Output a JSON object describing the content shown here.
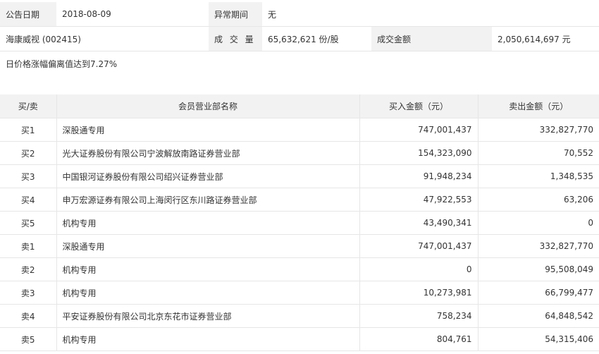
{
  "header": {
    "announce_date_label": "公告日期",
    "announce_date_value": "2018-08-09",
    "abnormal_period_label": "异常期间",
    "abnormal_period_value": "无",
    "stock_name": "海康威视 (002415)",
    "volume_label": "成 交 量",
    "volume_value": "65,632,621 份/股",
    "turnover_label": "成交金额",
    "turnover_value": "2,050,614,697 元",
    "reason": "日价格涨幅偏离值达到7.27%"
  },
  "table": {
    "columns": [
      "买/卖",
      "会员营业部名称",
      "买入金额（元）",
      "卖出金额（元）"
    ],
    "rows": [
      {
        "side": "买1",
        "name": "深股通专用",
        "buy": "747,001,437",
        "sell": "332,827,770"
      },
      {
        "side": "买2",
        "name": "光大证券股份有限公司宁波解放南路证券营业部",
        "buy": "154,323,090",
        "sell": "70,552"
      },
      {
        "side": "买3",
        "name": "中国银河证券股份有限公司绍兴证券营业部",
        "buy": "91,948,234",
        "sell": "1,348,535"
      },
      {
        "side": "买4",
        "name": "申万宏源证券有限公司上海闵行区东川路证券营业部",
        "buy": "47,922,553",
        "sell": "63,206"
      },
      {
        "side": "买5",
        "name": "机构专用",
        "buy": "43,490,341",
        "sell": "0"
      },
      {
        "side": "卖1",
        "name": "深股通专用",
        "buy": "747,001,437",
        "sell": "332,827,770"
      },
      {
        "side": "卖2",
        "name": "机构专用",
        "buy": "0",
        "sell": "95,508,049"
      },
      {
        "side": "卖3",
        "name": "机构专用",
        "buy": "10,273,981",
        "sell": "66,799,477"
      },
      {
        "side": "卖4",
        "name": "平安证券股份有限公司北京东花市证券营业部",
        "buy": "758,234",
        "sell": "64,848,542"
      },
      {
        "side": "卖5",
        "name": "机构专用",
        "buy": "804,761",
        "sell": "54,315,406"
      }
    ]
  }
}
